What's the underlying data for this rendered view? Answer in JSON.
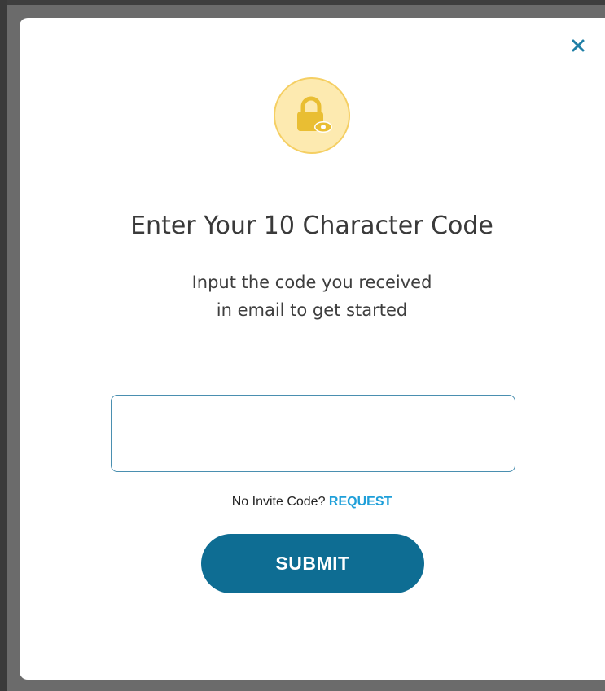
{
  "modal": {
    "close_label": "×",
    "lock_icon": "lock-eye-icon",
    "title": "Enter Your 10 Character Code",
    "subtitle_lines": [
      "Input the code you received",
      "in email to get started"
    ],
    "code_input": {
      "value": "",
      "placeholder": ""
    },
    "invite": {
      "prompt": "No Invite Code? ",
      "link_label": "REQUEST"
    },
    "submit_label": "SUBMIT"
  },
  "colors": {
    "accent": "#0e6d93",
    "link": "#1e9fd9",
    "badge_fill": "#fdeab0",
    "badge_border": "#f5cf63",
    "lock": "#e9be33"
  }
}
